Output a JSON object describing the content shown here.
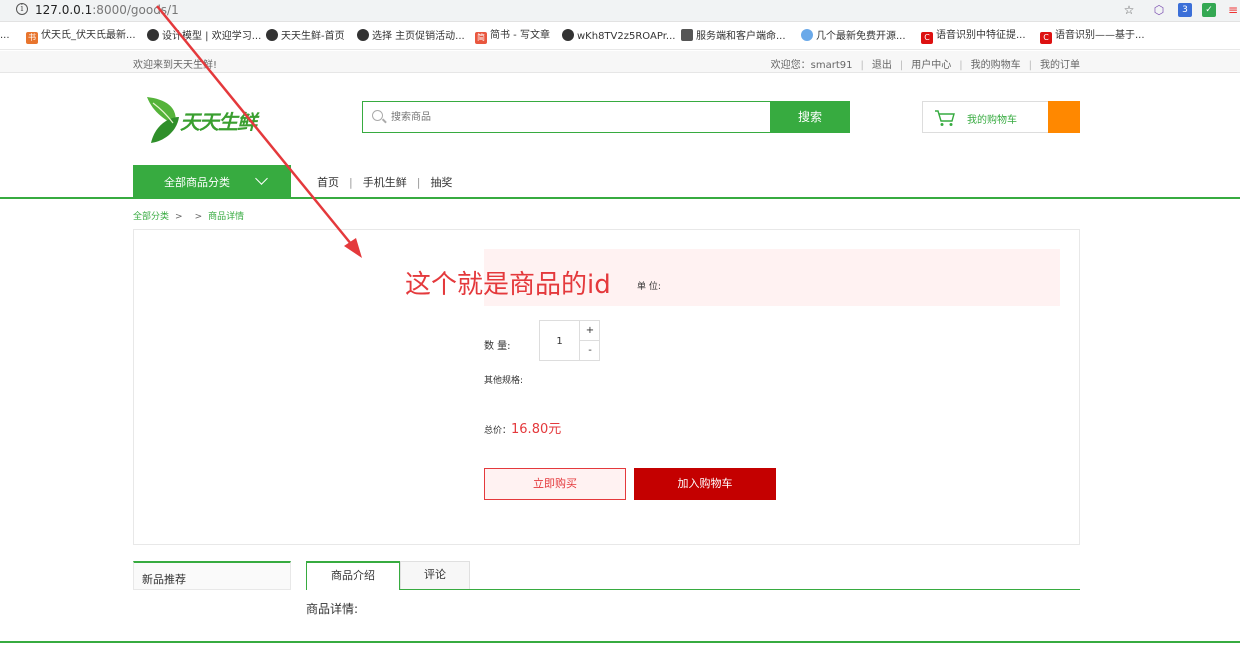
{
  "browser": {
    "url_host": "127.0.0.1",
    "url_path": ":8000/goods/1",
    "bookmarks": [
      "伏天氏_伏天氏最新...",
      "设计模型 | 欢迎学习...",
      "天天生鲜-首页",
      "选择 主页促销活动...",
      "简书 - 写文章",
      "wKh8TV2z5ROAPr...",
      "服务端和客户端命...",
      "几个最新免费开源...",
      "语音识别中特征提...",
      "语音识别——基于..."
    ]
  },
  "topbar": {
    "welcome": "欢迎来到天天生鲜!",
    "user_greeting": "欢迎您：smart91",
    "links": [
      "退出",
      "用户中心",
      "我的购物车",
      "我的订单"
    ]
  },
  "header": {
    "logo_text": "天天生鲜",
    "search_placeholder": "搜索商品",
    "search_button": "搜索",
    "cart_label": "我的购物车",
    "cart_count": ""
  },
  "nav": {
    "all_categories": "全部商品分类",
    "links": [
      "首页",
      "手机生鲜",
      "抽奖"
    ]
  },
  "breadcrumb": {
    "root": "全部分类",
    "current": "商品详情"
  },
  "product": {
    "unit_label": "单 位:",
    "qty_label": "数 量:",
    "qty_value": "1",
    "plus": "+",
    "minus": "-",
    "spec_label": "其他规格:",
    "total_label": "总价：",
    "total_value": "16.80元",
    "buy_now": "立即购买",
    "add_to_cart": "加入购物车"
  },
  "lower": {
    "new_recommend": "新品推荐",
    "tabs": [
      "商品介绍",
      "评论"
    ],
    "detail_title": "商品详情:"
  },
  "annotation": {
    "text": "这个就是商品的id",
    "color": "#e4393c"
  },
  "colors": {
    "brand_green": "#37ab40",
    "price_red": "#e4393c",
    "cart_button": "#c40000",
    "cart_count_bg": "#ff8800"
  }
}
